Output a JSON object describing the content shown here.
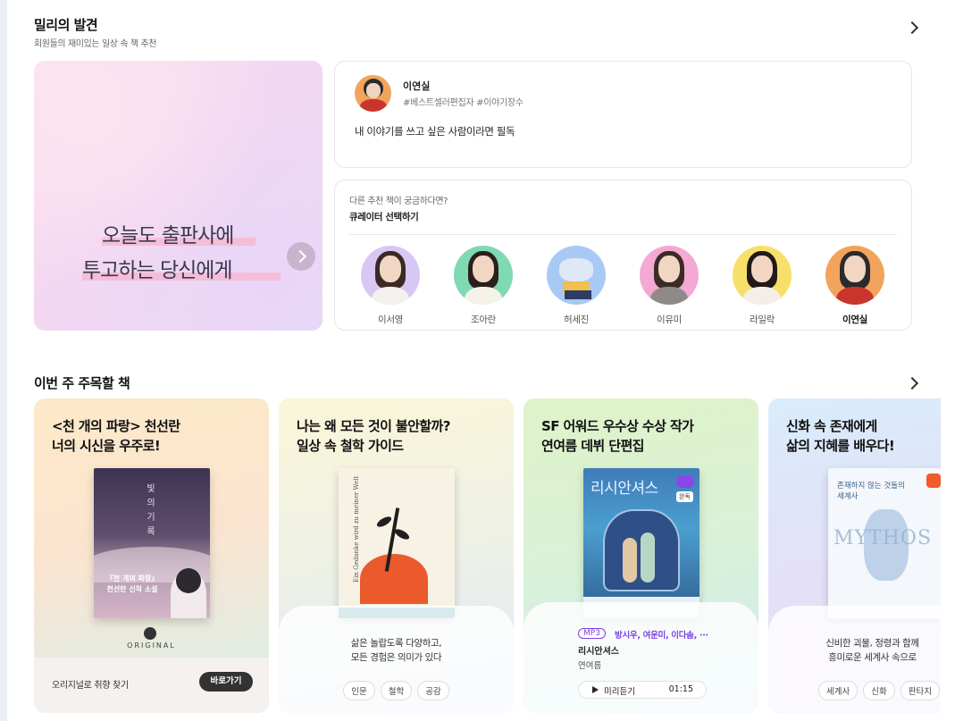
{
  "section1": {
    "title": "밀리의 발견",
    "subtitle": "회원들의 재미있는 일상 속 책 추천",
    "hero": {
      "line1": "오늘도 출판사에",
      "line2": "투고하는 당신에게",
      "slides": 4,
      "active_slide": 0
    },
    "curator": {
      "name": "이연실",
      "tags": "#베스트셀러편집자 #이야기장수",
      "quote": "내 이야기를 쓰고 싶은 사람이라면 필독"
    },
    "picker": {
      "question": "다른 추천 책이 궁금하다면?",
      "title": "큐레이터 선택하기",
      "curators": [
        {
          "name": "이서영",
          "color": "#d8c7f3"
        },
        {
          "name": "조아란",
          "color": "#7fd9b3"
        },
        {
          "name": "허세진",
          "color": "#a9c9f5"
        },
        {
          "name": "이유미",
          "color": "#f4a9d2"
        },
        {
          "name": "라일락",
          "color": "#f6e06a"
        },
        {
          "name": "이연실",
          "color": "#f3a45c",
          "selected": true
        }
      ]
    }
  },
  "section2": {
    "title": "이번 주 주목할 책",
    "cards": [
      {
        "title": "<천 개의 파랑> 천선란\n너의 시신을 우주로!",
        "cover_title": "빛의 기록",
        "cover_caption": "『천 개의 파랑』\n천선란 신작 소설",
        "original_label": "ORIGINAL",
        "bottom_text": "오리지널로 취향 찾기",
        "button": "바로가기"
      },
      {
        "title": "나는 왜 모든 것이 불안할까?\n일상 속 철학 가이드",
        "cover_title": "Ein Gedanke wird zu meiner Welt",
        "description": "삶은 놀랍도록 다양하고,\n모든 경험은 의미가 있다",
        "chips": [
          "인문",
          "철학",
          "공감"
        ]
      },
      {
        "title": "SF 어워드 우수상 수상 작가\n연여름 데뷔 단편집",
        "cover_title": "리시안셔스",
        "cover_badge": "완독",
        "format": "MP3",
        "narrators": "방시우, 여운미, 이다솜, ···",
        "book_title": "리시안셔스",
        "author": "연여름",
        "play_label": "미리듣기",
        "duration": "01:15"
      },
      {
        "title": "신화 속 존재에게\n삶의 지혜를 배우다!",
        "cover_title": "존재하지 않는 것들의\n세계사",
        "cover_word": "MYTHOS",
        "description": "신비한 괴물, 정령과 함께\n흥미로운 세계사 속으로",
        "chips": [
          "세계사",
          "신화",
          "판타지"
        ]
      }
    ]
  },
  "colors": {
    "accent": "#7b3fe4",
    "dark_button": "#333333"
  }
}
